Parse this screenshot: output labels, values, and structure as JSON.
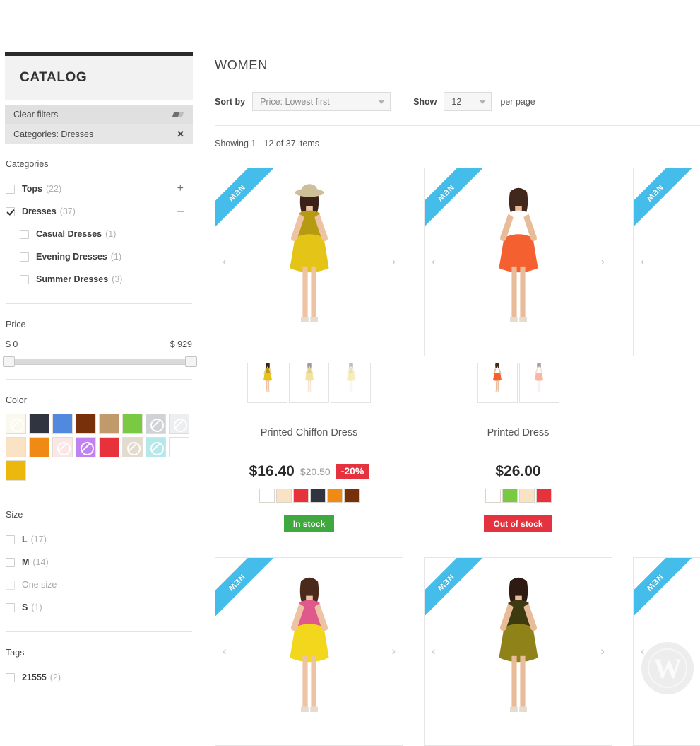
{
  "sidebar": {
    "title": "CATALOG",
    "active_filters": [
      {
        "label": "Clear filters",
        "icon": "eraser-icon"
      },
      {
        "label": "Categories: Dresses",
        "icon": "close-icon"
      }
    ],
    "categories": {
      "title": "Categories",
      "items": [
        {
          "label": "Tops",
          "count": "(22)",
          "checked": false,
          "expander": "+",
          "level": 0
        },
        {
          "label": "Dresses",
          "count": "(37)",
          "checked": true,
          "expander": "–",
          "level": 0
        },
        {
          "label": "Casual Dresses",
          "count": "(1)",
          "checked": false,
          "expander": "",
          "level": 1
        },
        {
          "label": "Evening Dresses",
          "count": "(1)",
          "checked": false,
          "expander": "",
          "level": 1
        },
        {
          "label": "Summer Dresses",
          "count": "(3)",
          "checked": false,
          "expander": "",
          "level": 1
        }
      ]
    },
    "price": {
      "title": "Price",
      "min_label": "$ 0",
      "max_label": "$ 929"
    },
    "color": {
      "title": "Color",
      "swatches": [
        {
          "hex": "#fbf8ee",
          "disabled": true
        },
        {
          "hex": "#2f3440",
          "disabled": false
        },
        {
          "hex": "#5089dd",
          "disabled": false
        },
        {
          "hex": "#77300a",
          "disabled": false
        },
        {
          "hex": "#c09a6b",
          "disabled": false
        },
        {
          "hex": "#7ac943",
          "disabled": false
        },
        {
          "hex": "#cfd3d6",
          "disabled": true
        },
        {
          "hex": "#eceeef",
          "disabled": true
        },
        {
          "hex": "#fae3c4",
          "disabled": false
        },
        {
          "hex": "#ef8a15",
          "disabled": false
        },
        {
          "hex": "#fbe6e6",
          "disabled": true
        },
        {
          "hex": "#bf82f0",
          "disabled": true
        },
        {
          "hex": "#e7323b",
          "disabled": false
        },
        {
          "hex": "#e3dbcd",
          "disabled": true
        },
        {
          "hex": "#b4e8ea",
          "disabled": true
        },
        {
          "hex": "#ffffff",
          "disabled": false
        },
        {
          "hex": "#eab90c",
          "disabled": false
        }
      ]
    },
    "size": {
      "title": "Size",
      "items": [
        {
          "label": "L",
          "count": "(17)",
          "muted": false
        },
        {
          "label": "M",
          "count": "(14)",
          "muted": false
        },
        {
          "label": "One size",
          "count": "",
          "muted": true
        },
        {
          "label": "S",
          "count": "(1)",
          "muted": false
        }
      ]
    },
    "tags": {
      "title": "Tags",
      "items": [
        {
          "label": "21555",
          "count": "(2)",
          "muted": false
        }
      ]
    }
  },
  "main": {
    "page_title": "WOMEN",
    "toolbar": {
      "sort_label": "Sort by",
      "sort_value": "Price: Lowest first",
      "show_label": "Show",
      "show_value": "12",
      "per_page_label": "per page"
    },
    "showing": "Showing 1 - 12 of 37 items",
    "ribbon_label": "NEW",
    "arrow_prev": "‹",
    "arrow_next": "›",
    "products_row1": [
      {
        "name": "Printed Chiffon Dress",
        "price": "$16.40",
        "old_price": "$20.50",
        "discount": "-20%",
        "stock": "In stock",
        "stock_state": "in",
        "new": true,
        "thumbs": 3,
        "colors": [
          "#ffffff",
          "#fae3c4",
          "#e7323b",
          "#2f3440",
          "#ef8a15",
          "#77300a"
        ],
        "model": {
          "dress": "#e3c417",
          "dress2": "#b59a12",
          "hat": "#cdbf98",
          "hair": "#3b2218",
          "skin": "#edc3a3"
        }
      },
      {
        "name": "Printed Dress",
        "price": "$26.00",
        "old_price": "",
        "discount": "",
        "stock": "Out of stock",
        "stock_state": "out",
        "new": true,
        "thumbs": 2,
        "colors": [
          "#ffffff",
          "#7ac943",
          "#fae3c4",
          "#e7323b"
        ],
        "model": {
          "dress": "#f4602f",
          "dress2": "#ffffff",
          "hat": "",
          "hair": "#42281c",
          "skin": "#e8bb99"
        }
      },
      {
        "name": "",
        "price": "",
        "old_price": "",
        "discount": "",
        "stock": "",
        "stock_state": "",
        "new": true,
        "thumbs": 1,
        "colors": [],
        "model": {
          "dress": "#262626",
          "dress2": "#ffffff",
          "hat": "",
          "hair": "#6d4b2e",
          "skin": "#ecc4a4"
        }
      }
    ],
    "products_row2": [
      {
        "new": true,
        "model": {
          "dress": "#f2d71d",
          "dress2": "#e0598c",
          "hair": "#4a2a1b",
          "skin": "#edc3a3"
        }
      },
      {
        "new": true,
        "model": {
          "dress": "#8f8218",
          "dress2": "#3d3a12",
          "hair": "#2d1a12",
          "skin": "#e8bb99"
        }
      },
      {
        "new": true,
        "model": {
          "dress": "#cfcfcf",
          "dress2": "#bdbdbd",
          "hair": "#3b2218",
          "skin": "#edc3a3"
        }
      }
    ]
  },
  "watermark": {
    "letter": "W"
  }
}
